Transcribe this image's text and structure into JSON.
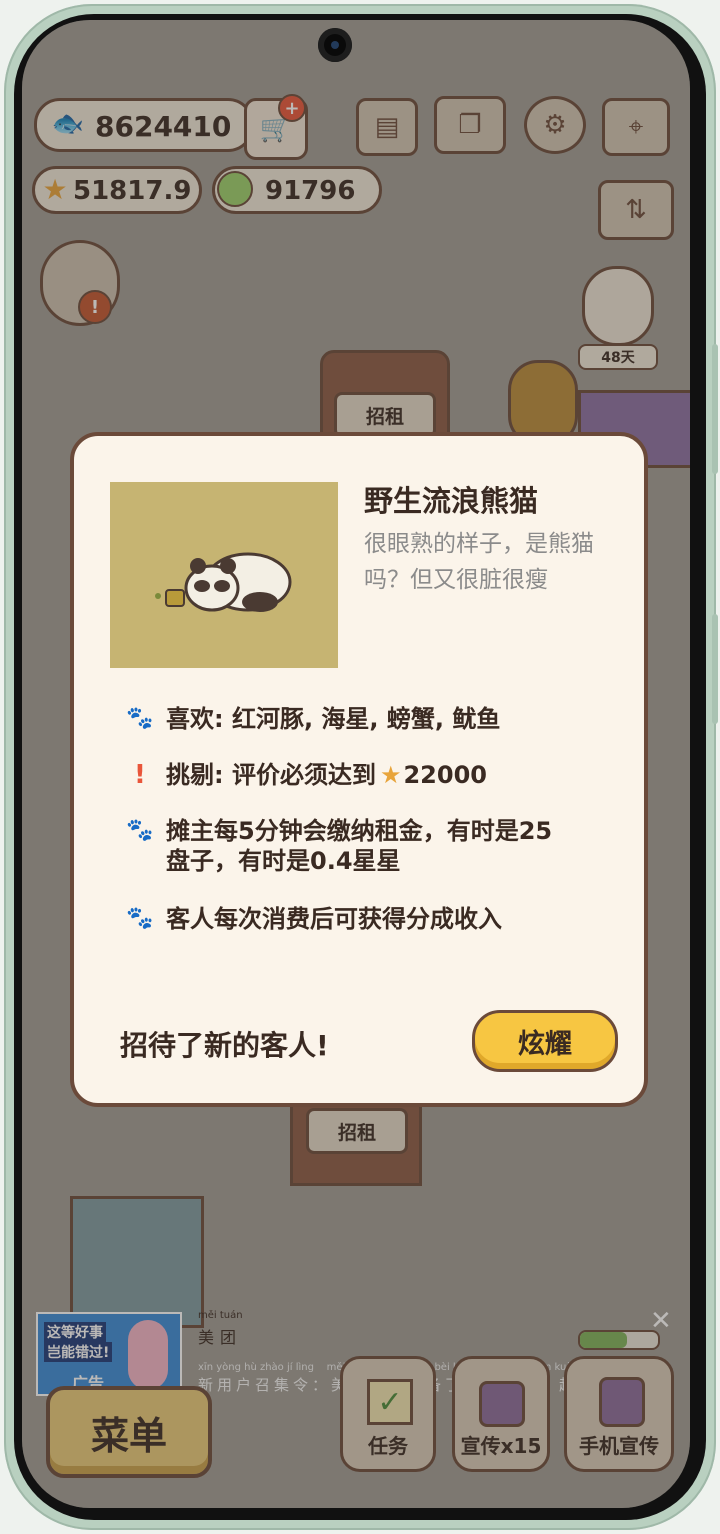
{
  "hud": {
    "fish_count": "8624410",
    "star_count": "51817.9",
    "coin_count": "91796",
    "days_badge": "48天"
  },
  "scene": {
    "stall_sign_top": "招租",
    "stall_sign_bottom": "招租"
  },
  "dialog": {
    "title": "野生流浪熊猫",
    "description": "很眼熟的样子，是熊猫吗？但又很脏很瘦",
    "rows": [
      {
        "icon": "paw-icon",
        "text": "喜欢: 红河豚, 海星, 螃蟹, 鱿鱼"
      },
      {
        "icon": "exclamation-icon",
        "text": "挑剔: 评价必须达到",
        "value": "22000"
      },
      {
        "icon": "paw-icon",
        "text": "摊主每5分钟会缴纳租金，有时是25盘子，有时是0.4星星"
      },
      {
        "icon": "paw-icon",
        "text": "客人每次消费后可获得分成收入"
      }
    ],
    "footer": "招待了新的客人!",
    "brag_button": "炫耀"
  },
  "ad": {
    "banner_line1": "这等好事",
    "banner_line2": "岂能错过!",
    "banner_tag": "广告",
    "brand": "美团",
    "brand_pinyin": "měi tuán",
    "headline": "新用户召集令：美团为你准备了一份惊喜，赶快…",
    "headline_pinyin": "xīn yòng hù zhào jí lìng    měi tuán wèi nǐ zhǔn bèi le yí fèn jīng xǐ  gǎn kuài",
    "close_symbol": "✕"
  },
  "bottom": {
    "menu": "菜单",
    "task": "任务",
    "promote": "宣传x15",
    "phone_promote": "手机宣传"
  }
}
